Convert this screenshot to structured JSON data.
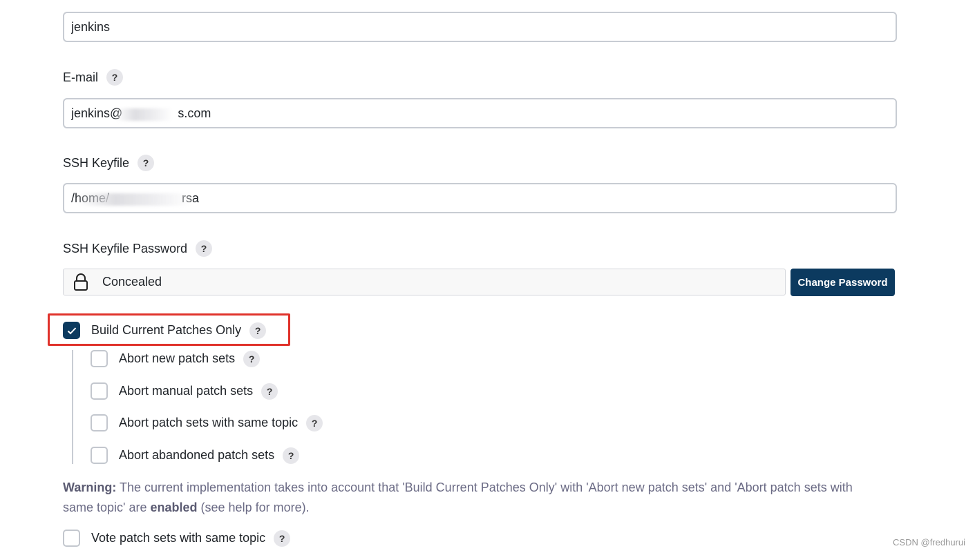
{
  "fields": {
    "username_value": "jenkins",
    "email": {
      "label": "E-mail",
      "value": "jenkins@                s.com"
    },
    "ssh_keyfile": {
      "label": "SSH Keyfile",
      "value": "/home/                     rsa"
    },
    "ssh_keyfile_password": {
      "label": "SSH Keyfile Password",
      "concealed_text": "Concealed",
      "change_button": "Change Password"
    }
  },
  "options": {
    "build_current_patches_only": {
      "label": "Build Current Patches Only",
      "checked": true
    },
    "sub_options": [
      {
        "label": "Abort new patch sets",
        "checked": false
      },
      {
        "label": "Abort manual patch sets",
        "checked": false
      },
      {
        "label": "Abort patch sets with same topic",
        "checked": false
      },
      {
        "label": "Abort abandoned patch sets",
        "checked": false
      }
    ],
    "vote_patch_sets": {
      "label": "Vote patch sets with same topic",
      "checked": false
    }
  },
  "warning": {
    "prefix": "Warning:",
    "text_1": " The current implementation takes into account that 'Build Current Patches Only' with 'Abort new patch sets' and 'Abort patch sets with same topic' are ",
    "bold": "enabled",
    "text_2": " (see help for more)."
  },
  "help_symbol": "?",
  "watermark": "CSDN @fredhurui",
  "colors": {
    "accent": "#0c3a5f",
    "highlight": "#e0322b",
    "input_border": "#c8ccd3"
  }
}
